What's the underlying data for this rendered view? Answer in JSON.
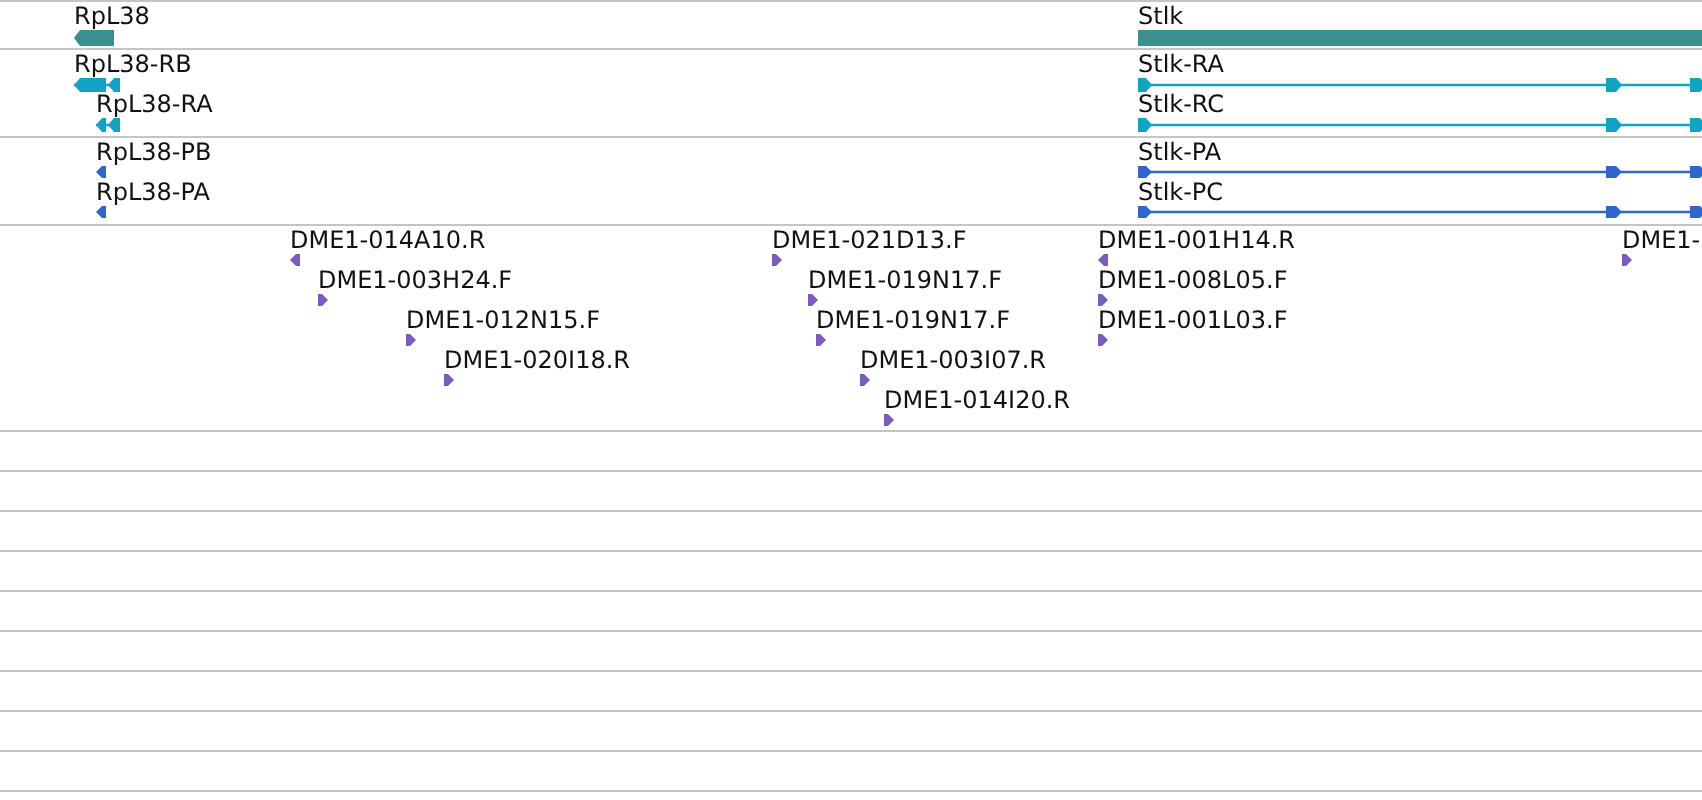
{
  "tracks": [
    {
      "kind": "gene",
      "features": [
        {
          "label": "RpL38",
          "reverse_strand": true
        },
        {
          "label": "Stlk",
          "reverse_strand": false
        }
      ]
    },
    {
      "kind": "transcript",
      "features": [
        {
          "label": "RpL38-RB",
          "reverse_strand": true
        },
        {
          "label": "RpL38-RA",
          "reverse_strand": true
        },
        {
          "label": "Stlk-RA",
          "reverse_strand": false
        },
        {
          "label": "Stlk-RC",
          "reverse_strand": false
        }
      ]
    },
    {
      "kind": "protein",
      "features": [
        {
          "label": "RpL38-PB",
          "reverse_strand": true
        },
        {
          "label": "RpL38-PA",
          "reverse_strand": true
        },
        {
          "label": "Stlk-PA",
          "reverse_strand": false
        },
        {
          "label": "Stlk-PC",
          "reverse_strand": false
        }
      ]
    },
    {
      "kind": "est",
      "features": [
        {
          "label": "DME1-014A10.R",
          "reverse_strand": true
        },
        {
          "label": "DME1-003H24.F",
          "reverse_strand": false
        },
        {
          "label": "DME1-012N15.F",
          "reverse_strand": false
        },
        {
          "label": "DME1-020I18.R",
          "reverse_strand": false
        },
        {
          "label": "DME1-021D13.F",
          "reverse_strand": false
        },
        {
          "label": "DME1-019N17.F",
          "reverse_strand": false
        },
        {
          "label": "DME1-019N17.F",
          "reverse_strand": false
        },
        {
          "label": "DME1-003I07.R",
          "reverse_strand": false
        },
        {
          "label": "DME1-014I20.R",
          "reverse_strand": false
        },
        {
          "label": "DME1-001H14.R",
          "reverse_strand": true
        },
        {
          "label": "DME1-008L05.F",
          "reverse_strand": false
        },
        {
          "label": "DME1-001L03.F",
          "reverse_strand": false
        },
        {
          "label": "DME1-",
          "reverse_strand": false
        }
      ]
    }
  ]
}
